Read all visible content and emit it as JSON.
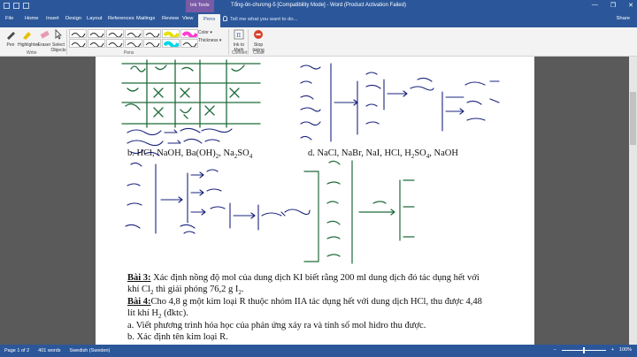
{
  "window": {
    "title": "Tổng-ôn-chương-5 [Compatibility Mode] - Word (Product Activation Failed)",
    "context_group": "Ink Tools",
    "controls": [
      "—",
      "❐",
      "✕"
    ]
  },
  "tabs": [
    "File",
    "Home",
    "Insert",
    "Design",
    "Layout",
    "References",
    "Mailings",
    "Review",
    "View",
    "Pens"
  ],
  "active_tab": "Pens",
  "tell_me": "Tell me what you want to do...",
  "share": "Share",
  "ribbon": {
    "pen": "Pen",
    "highlighter": "Highlighter",
    "eraser": "Eraser",
    "select_objects": "Select Objects",
    "write_group": "Write",
    "pens_group": "Pens",
    "color": "Color",
    "thickness": "Thickness",
    "ink_to_math": "Ink to Math",
    "convert_group": "Convert",
    "stop_inking": "Stop Inking",
    "close_group": "Close"
  },
  "document": {
    "line_b": "b. HCl,  NaOH,  Ba(OH)",
    "line_b_tail": ", Na",
    "line_b_tail2": "SO",
    "line_d": "d. NaCl,  NaBr,  NaI,  HCl,  H",
    "line_d_tail": "SO",
    "line_d_tail2": ",  NaOH",
    "bai3_title": "Bài 3:",
    "bai3_text": " Xác định nồng độ mol của dung dịch KI biết rằng 200 ml dung dịch đó tác dụng hết với",
    "bai3_text2": "khí Cl",
    "bai3_text2b": " thì giải phóng 76,2 g I",
    "bai3_text2c": ".",
    "bai4_title": "Bài 4:",
    "bai4_text": "Cho 4,8 g một kim loại R thuộc nhóm IIA tác dụng hết với dung dịch HCl, thu được 4,48",
    "bai4_text2": "lít khí H",
    "bai4_text2b": " (đktc).",
    "bai4_a": "a. Viết phương trình hóa học của phản ứng xảy ra và tính số mol hidro thu được.",
    "bai4_b": "b. Xác định tên kim loại R.",
    "sub2": "2",
    "sub4": "4"
  },
  "status": {
    "page": "Page 1 of 2",
    "words": "401 words",
    "language": "Swedish (Sweden)",
    "zoom": "100%"
  }
}
